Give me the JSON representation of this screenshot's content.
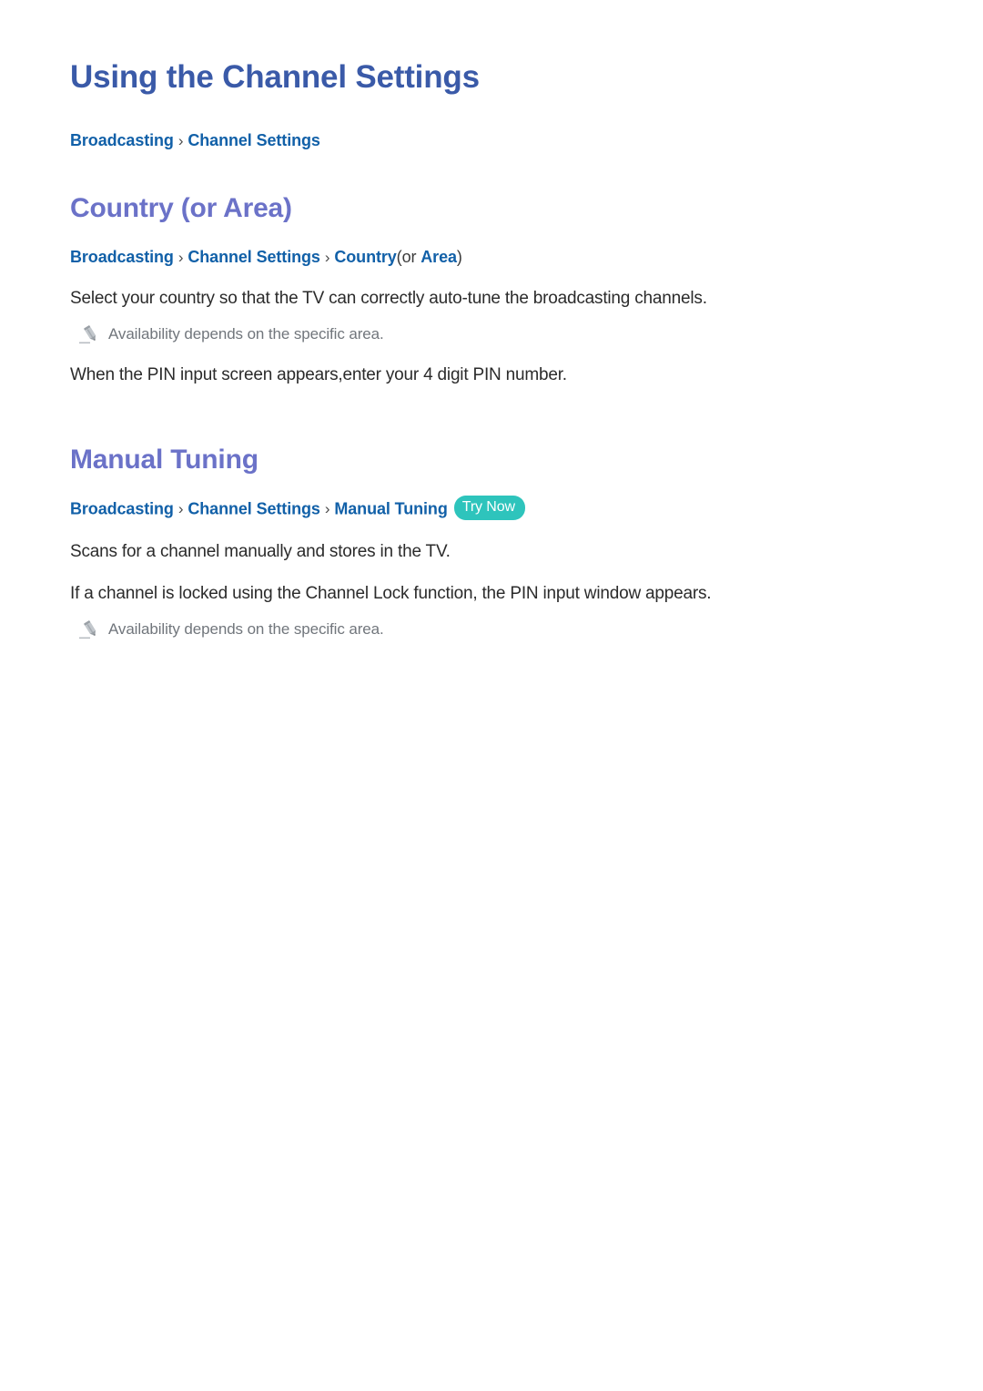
{
  "document": {
    "title": "Using the Channel Settings",
    "top_breadcrumb": {
      "items": [
        "Broadcasting",
        "Channel Settings"
      ],
      "separator": "›"
    }
  },
  "sections": [
    {
      "heading": "Country (or Area)",
      "breadcrumb": {
        "items": [
          "Broadcasting",
          "Channel Settings",
          "Country"
        ],
        "separator": "›",
        "suffix_open": "(or ",
        "suffix_link": "Area",
        "suffix_close": ")"
      },
      "paragraphs": [
        "Select your country so that the TV can correctly auto-tune the broadcasting channels."
      ],
      "note": {
        "icon": "pencil-icon",
        "text": "Availability depends on the specific area."
      },
      "paragraphs_after_note": [
        "When the PIN input screen appears,enter your 4 digit PIN number."
      ]
    },
    {
      "heading": "Manual Tuning",
      "breadcrumb": {
        "items": [
          "Broadcasting",
          "Channel Settings",
          "Manual Tuning"
        ],
        "separator": "›",
        "badge": "Try Now"
      },
      "paragraphs": [
        "Scans for a channel manually and stores in the TV.",
        "If a channel is locked using the Channel Lock function, the PIN input window appears."
      ],
      "note": {
        "icon": "pencil-icon",
        "text": "Availability depends on the specific area."
      }
    }
  ],
  "colors": {
    "page_title": "#3a5aa8",
    "section_heading": "#6b72c8",
    "breadcrumb_link": "#1160a8",
    "body_text": "#2b2b2b",
    "note_text": "#71767c",
    "badge_background": "#2ec4bc",
    "badge_text": "#ffffff",
    "background": "#ffffff"
  }
}
